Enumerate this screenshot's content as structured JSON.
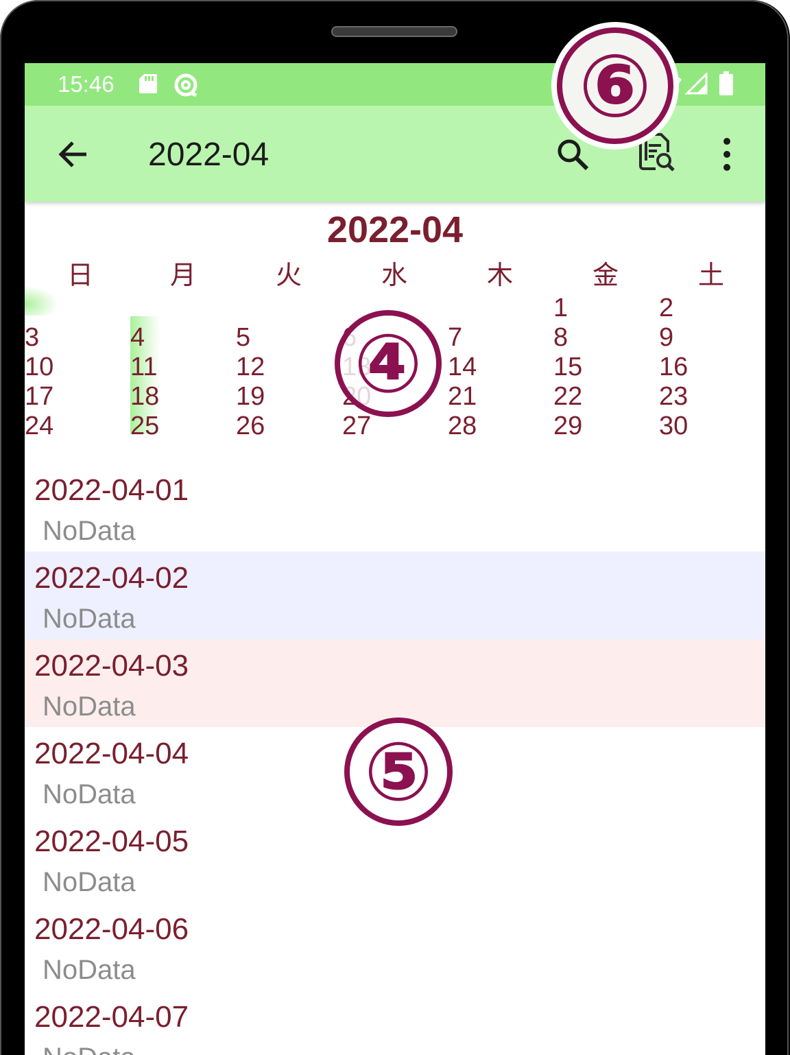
{
  "status_bar": {
    "time": "15:46",
    "icons": [
      "sd-card-icon",
      "sync-icon",
      "wifi-icon",
      "signal-icon",
      "battery-icon"
    ]
  },
  "app_bar": {
    "title": "2022-04",
    "actions": [
      "back-arrow-icon",
      "search-icon",
      "report-search-icon",
      "more-vert-icon"
    ]
  },
  "calendar": {
    "title": "2022-04",
    "weekdays": [
      "日",
      "月",
      "火",
      "水",
      "木",
      "金",
      "土"
    ],
    "highlight_color": "#a9f09a",
    "weeks": [
      [
        "",
        "",
        "",
        "",
        "",
        "1",
        "2"
      ],
      [
        "3",
        "4",
        "5",
        "6",
        "7",
        "8",
        "9"
      ],
      [
        "10",
        "11",
        "12",
        "13",
        "14",
        "15",
        "16"
      ],
      [
        "17",
        "18",
        "19",
        "20",
        "21",
        "22",
        "23"
      ],
      [
        "24",
        "25",
        "26",
        "27",
        "28",
        "29",
        "30"
      ]
    ]
  },
  "day_list": [
    {
      "date": "2022-04-01",
      "status": "NoData",
      "kind": "weekday"
    },
    {
      "date": "2022-04-02",
      "status": "NoData",
      "kind": "sat"
    },
    {
      "date": "2022-04-03",
      "status": "NoData",
      "kind": "sun"
    },
    {
      "date": "2022-04-04",
      "status": "NoData",
      "kind": "weekday"
    },
    {
      "date": "2022-04-05",
      "status": "NoData",
      "kind": "weekday"
    },
    {
      "date": "2022-04-06",
      "status": "NoData",
      "kind": "weekday"
    },
    {
      "date": "2022-04-07",
      "status": "NoData",
      "kind": "weekday"
    }
  ],
  "callouts": {
    "four": "④",
    "five": "⑤",
    "six": "⑥"
  },
  "colors": {
    "status_bar": "#92e87f",
    "app_bar": "#b9f5ae",
    "accent_text": "#7a1f2f",
    "saturday_row": "#eef0ff",
    "sunday_row": "#fdeeed",
    "callout": "#8b1150"
  }
}
